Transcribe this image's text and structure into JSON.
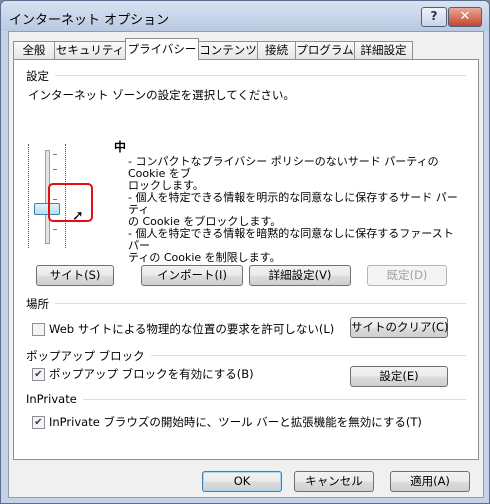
{
  "window": {
    "title": "インターネット オプション",
    "help": "?",
    "close": "✕"
  },
  "tabs": [
    "全般",
    "セキュリティ",
    "プライバシー",
    "コンテンツ",
    "接続",
    "プログラム",
    "詳細設定"
  ],
  "settings": {
    "label": "設定",
    "instruction": "インターネット ゾーンの設定を選択してください。",
    "level": "中",
    "lines": [
      "- コンパクトなプライバシー ポリシーのないサード パーティの Cookie をブ",
      "ロックします。",
      "- 個人を特定できる情報を明示的な同意なしに保存するサード パーティ",
      "の Cookie をブロックします。",
      "- 個人を特定できる情報を暗黙的な同意なしに保存するファースト パー",
      "ティの Cookie を制限します。"
    ],
    "buttons": {
      "sites": "サイト(S)",
      "import": "インポート(I)",
      "advanced": "詳細設定(V)",
      "default": "既定(D)"
    }
  },
  "location": {
    "label": "場所",
    "checkbox": "Web サイトによる物理的な位置の要求を許可しない(L)",
    "checked": false,
    "clear": "サイトのクリア(C)"
  },
  "popup": {
    "label": "ポップアップ ブロック",
    "checkbox": "ポップアップ ブロックを有効にする(B)",
    "checked": true,
    "settings": "設定(E)"
  },
  "inprivate": {
    "label": "InPrivate",
    "checkbox": "InPrivate ブラウズの開始時に、ツール バーと拡張機能を無効にする(T)",
    "checked": true
  },
  "footer": {
    "ok": "OK",
    "cancel": "キャンセル",
    "apply": "適用(A)"
  }
}
